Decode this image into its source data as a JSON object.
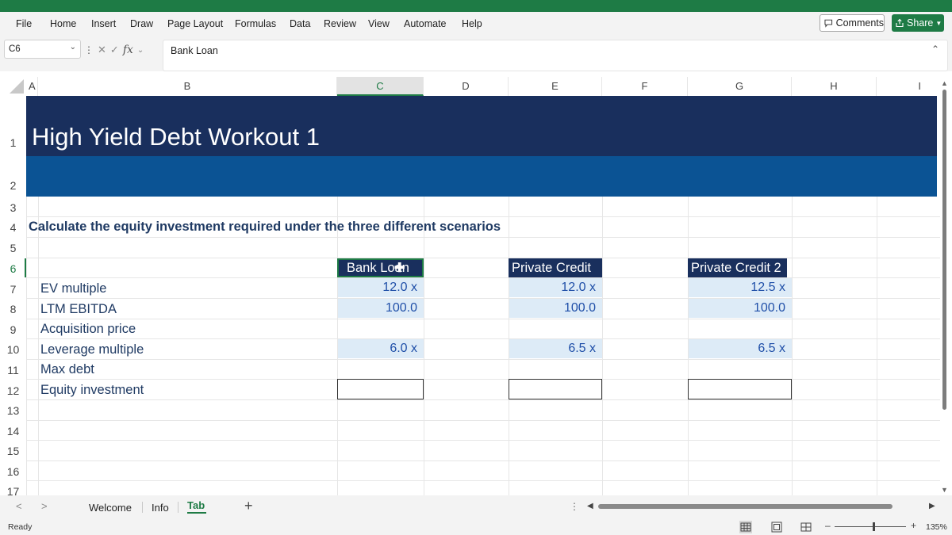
{
  "ribbon": {
    "tabs": [
      "File",
      "Home",
      "Insert",
      "Draw",
      "Page Layout",
      "Formulas",
      "Data",
      "Review",
      "View",
      "Automate",
      "Help"
    ],
    "comments_label": "Comments",
    "share_label": "Share"
  },
  "formula_bar": {
    "name_box": "C6",
    "fx_label": "fx",
    "formula": "Bank Loan"
  },
  "columns": [
    "A",
    "B",
    "C",
    "D",
    "E",
    "F",
    "G",
    "H",
    "I"
  ],
  "selected_column": "C",
  "rows": [
    "1",
    "2",
    "3",
    "4",
    "5",
    "6",
    "7",
    "8",
    "9",
    "10",
    "11",
    "12",
    "13",
    "14",
    "15",
    "16",
    "17"
  ],
  "selected_row": "6",
  "sheet": {
    "title": "High Yield Debt Workout 1",
    "instruction": "Calculate the equity investment required under the three different scenarios",
    "labels": [
      "EV multiple",
      "LTM EBITDA",
      "Acquisition price",
      "Leverage multiple",
      "Max debt",
      "Equity investment"
    ],
    "scenarios": [
      {
        "name": "Bank Loan",
        "ev_multiple": "12.0 x",
        "ltm_ebitda": "100.0",
        "leverage_multiple": "6.0 x"
      },
      {
        "name": "Private Credit",
        "ev_multiple": "12.0 x",
        "ltm_ebitda": "100.0",
        "leverage_multiple": "6.5 x"
      },
      {
        "name": "Private Credit 2",
        "ev_multiple": "12.5 x",
        "ltm_ebitda": "100.0",
        "leverage_multiple": "6.5 x"
      }
    ]
  },
  "sheet_tabs": [
    "Welcome",
    "Info",
    "Tab"
  ],
  "active_sheet_tab": "Tab",
  "status": {
    "ready": "Ready",
    "zoom": "135%"
  },
  "colors": {
    "excel_green": "#1e7b45",
    "banner_dark": "#192f5d",
    "banner_blue": "#0b5394",
    "input_fill": "#ddebf7",
    "input_text": "#1f4fa8"
  }
}
